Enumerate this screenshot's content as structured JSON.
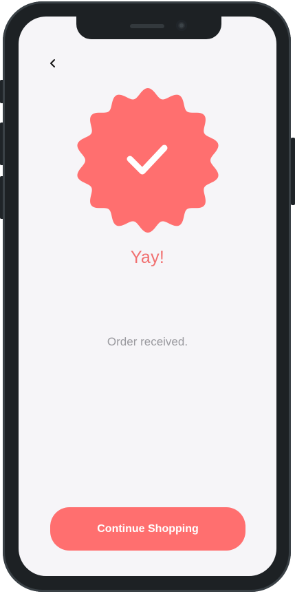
{
  "header": {
    "back_icon": "chevron-left-icon"
  },
  "badge": {
    "shape": "scalloped-seal",
    "icon": "checkmark-icon",
    "color": "#ff6f6f"
  },
  "message": {
    "title": "Yay!",
    "subtitle": "Order received."
  },
  "actions": {
    "continue_label": "Continue Shopping"
  },
  "theme": {
    "accent": "#ff6f6f",
    "background": "#f6f5f8",
    "frame": "#1d2124"
  }
}
